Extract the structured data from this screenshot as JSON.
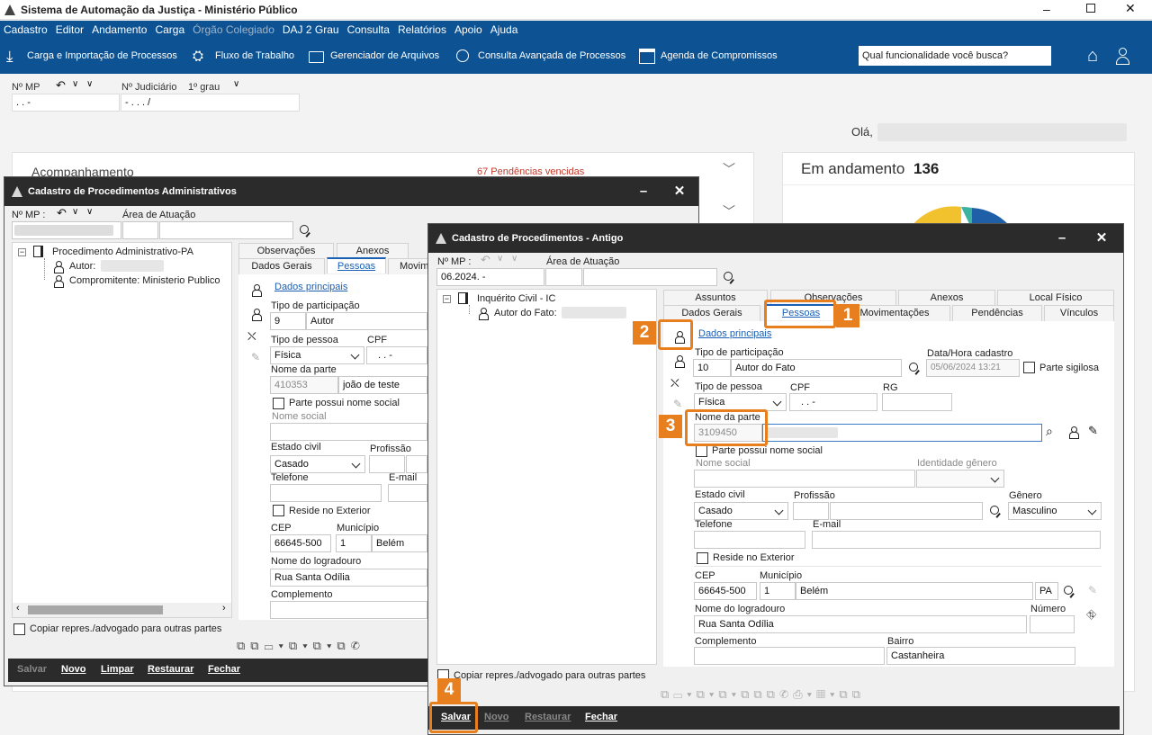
{
  "app": {
    "title": "Sistema de Automação da Justiça - Ministério Público"
  },
  "menu": [
    "Cadastro",
    "Editor",
    "Andamento",
    "Carga",
    "Órgão Colegiado",
    "DAJ 2 Grau",
    "Consulta",
    "Relatórios",
    "Apoio",
    "Ajuda"
  ],
  "toolbar": {
    "items": [
      "Carga e Importação de Processos",
      "Fluxo de Trabalho",
      "Gerenciador de Arquivos",
      "Consulta Avançada de Processos",
      "Agenda de Compromissos"
    ],
    "search_placeholder": "Qual funcionalidade você busca?"
  },
  "main": {
    "nmp_label": "Nº MP",
    "nmp_value": ".   .        -",
    "njud_label": "Nº Judiciário",
    "grau": "1º grau",
    "njud_value": "-    .    .   .     /",
    "greeting": "Olá,",
    "acomp": "Acompanhamento",
    "pendencias": "67 Pendências vencidas",
    "andamento_label": "Em andamento",
    "andamento_count": "136"
  },
  "win1": {
    "title": "Cadastro de Procedimentos Administrativos",
    "nmp_label": "Nº MP :",
    "area_label": "Área de Atuação",
    "tree": {
      "root": "Procedimento Administrativo-PA",
      "autor": "Autor:",
      "comp": "Compromitente: Ministerio Publico"
    },
    "tabs_top": [
      "Observações",
      "Anexos"
    ],
    "tabs": [
      "Dados Gerais",
      "Pessoas",
      "Movim"
    ],
    "dados_principais": "Dados principais",
    "tipo_part_label": "Tipo de participação",
    "tipo_part_code": "9",
    "tipo_part_value": "Autor",
    "tipo_pessoa_label": "Tipo de pessoa",
    "tipo_pessoa": "Física",
    "cpf_label": "CPF",
    "cpf_value": ".   .     -",
    "nome_parte_label": "Nome da parte",
    "nome_parte_code": "410353",
    "nome_parte": "joão de teste",
    "nome_social_chk": "Parte possui nome social",
    "nome_social_label": "Nome social",
    "estado_civil_label": "Estado civil",
    "estado_civil": "Casado",
    "profissao_label": "Profissão",
    "telefone_label": "Telefone",
    "email_label": "E-mail",
    "reside_exterior": "Reside no Exterior",
    "cep_label": "CEP",
    "cep": "66645-500",
    "municipio_label": "Município",
    "municipio_code": "1",
    "municipio": "Belém",
    "logradouro_label": "Nome do logradouro",
    "logradouro": "Rua Santa Odília",
    "complemento_label": "Complemento",
    "copiar": "Copiar repres./advogado para outras partes",
    "buttons": [
      "Salvar",
      "Novo",
      "Limpar",
      "Restaurar",
      "Fechar"
    ]
  },
  "win2": {
    "title": "Cadastro de Procedimentos - Antigo",
    "nmp_label": "Nº MP :",
    "nmp_value": "06.2024.         -",
    "area_label": "Área de Atuação",
    "tree": {
      "root": "Inquérito Civil - IC",
      "autor": "Autor do Fato:"
    },
    "tabs_top": [
      "Assuntos",
      "Observações",
      "Anexos",
      "Local Físico"
    ],
    "tabs": [
      "Dados Gerais",
      "Pessoas",
      "Movimentações",
      "Pendências",
      "Vínculos"
    ],
    "dados_principais": "Dados principais",
    "tipo_part_label": "Tipo de participação",
    "tipo_part_code": "10",
    "tipo_part_value": "Autor do Fato",
    "data_hora_label": "Data/Hora cadastro",
    "data_hora": "05/06/2024 13:21",
    "parte_sigilosa": "Parte sigilosa",
    "tipo_pessoa_label": "Tipo de pessoa",
    "tipo_pessoa": "Física",
    "cpf_label": "CPF",
    "cpf_value": ".   .     -",
    "rg_label": "RG",
    "nome_parte_label": "Nome da parte",
    "nome_parte_code": "3109450",
    "nome_social_chk": "Parte possui nome social",
    "nome_social_label": "Nome social",
    "identidade_label": "Identidade gênero",
    "estado_civil_label": "Estado civil",
    "estado_civil": "Casado",
    "profissao_label": "Profissão",
    "genero_label": "Gênero",
    "genero": "Masculino",
    "telefone_label": "Telefone",
    "email_label": "E-mail",
    "reside_exterior": "Reside no Exterior",
    "cep_label": "CEP",
    "cep": "66645-500",
    "municipio_label": "Município",
    "municipio_code": "1",
    "municipio": "Belém",
    "uf": "PA",
    "logradouro_label": "Nome do logradouro",
    "logradouro": "Rua Santa Odília",
    "numero_label": "Número",
    "complemento_label": "Complemento",
    "bairro_label": "Bairro",
    "bairro": "Castanheira",
    "copiar": "Copiar repres./advogado para outras partes",
    "buttons": [
      "Salvar",
      "Novo",
      "Restaurar",
      "Fechar"
    ]
  },
  "annotations": [
    "1",
    "2",
    "3",
    "4"
  ],
  "colors": {
    "nav": "#0d5394",
    "accent": "#e87f1e",
    "titlebar": "#2b2b2b",
    "link": "#1a5fb4",
    "pendencias": "#c0392b"
  }
}
